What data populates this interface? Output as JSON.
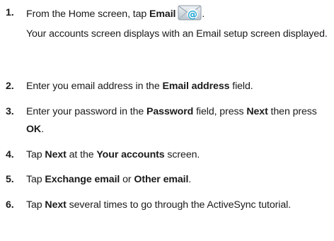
{
  "steps": [
    {
      "number": "1.",
      "before": "From the Home screen, tap ",
      "bold": "Email",
      "after": ".",
      "icon": "email-app-icon"
    },
    {
      "note": "Your accounts screen displays with an Email setup screen displayed."
    },
    {
      "number": "2.",
      "t1": "Enter you email address in the ",
      "b1": "Email address",
      "t2": " field."
    },
    {
      "number": "3.",
      "t1": "Enter your password in the ",
      "b1": "Password",
      "t2": " field, press ",
      "b2": "Next",
      "t3": " then press ",
      "b3": "OK",
      "t4": "."
    },
    {
      "number": "4.",
      "t1": "Tap ",
      "b1": "Next",
      "t2": " at the ",
      "b2": "Your accounts",
      "t3": " screen."
    },
    {
      "number": "5.",
      "t1": "Tap ",
      "b1": "Exchange email",
      "t2": " or ",
      "b2": "Other email",
      "t3": "."
    },
    {
      "number": "6.",
      "t1": "Tap ",
      "b1": "Next",
      "t2": " several times to go through the ActiveSync tutorial."
    }
  ],
  "colors": {
    "text": "#1a1a1a",
    "icon_envelope": "#c9d3dc",
    "icon_at": "#1aa6d6"
  }
}
